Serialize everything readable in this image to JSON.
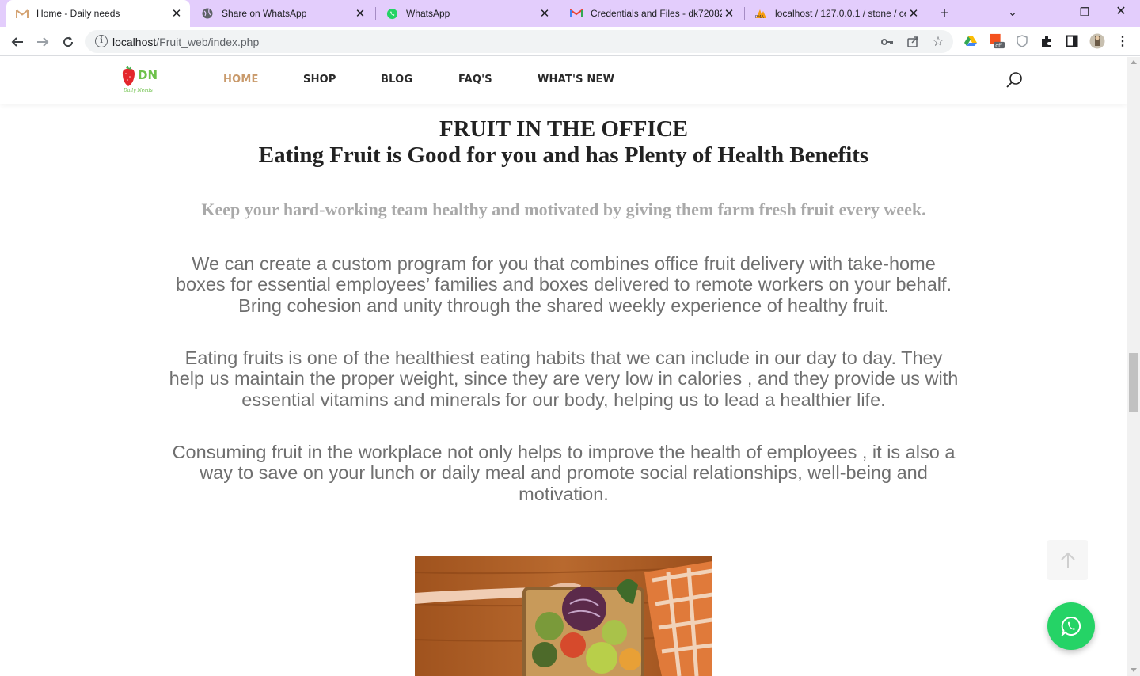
{
  "browser": {
    "tabs": [
      {
        "title": "Home - Daily needs",
        "icon": "gmail-icon",
        "active": true
      },
      {
        "title": "Share on WhatsApp",
        "icon": "globe-icon",
        "active": false
      },
      {
        "title": "WhatsApp",
        "icon": "whatsapp-icon",
        "active": false
      },
      {
        "title": "Credentials and Files - dk72082",
        "icon": "gmail-icon",
        "active": false
      },
      {
        "title": "localhost / 127.0.0.1 / stone / ce",
        "icon": "phpmyadmin-icon",
        "active": false
      }
    ],
    "url_host": "localhost",
    "url_path": "/Fruit_web/index.php",
    "extension_badge": "off"
  },
  "site": {
    "logo_text": "DN",
    "logo_subtext": "Daily Needs",
    "nav": [
      {
        "label": "HOME",
        "active": true
      },
      {
        "label": "SHOP",
        "active": false
      },
      {
        "label": "BLOG",
        "active": false
      },
      {
        "label": "FAQ'S",
        "active": false
      },
      {
        "label": "WHAT'S NEW",
        "active": false
      }
    ]
  },
  "content": {
    "heading": "FRUIT IN THE OFFICE",
    "subheading": "Eating Fruit is Good for you and has Plenty of Health Benefits",
    "tagline": "Keep your hard-working team healthy and motivated by giving them farm fresh fruit every week.",
    "paragraphs": [
      "We can create a custom program for you that combines office fruit delivery with take-home boxes for essential employees’ families and boxes delivered to remote workers on your behalf. Bring cohesion and unity through the shared weekly experience of healthy fruit.",
      "Eating fruits is one of the healthiest eating habits that we can include in our day to day. They help us maintain the proper weight, since they are very low in calories , and they provide us with essential vitamins and minerals for our body, helping us to lead a healthier life.",
      "Consuming fruit in the workplace not only helps to improve the health of employees , it is also a way to save on your lunch or daily meal and promote social relationships, well-being and motivation."
    ]
  },
  "colors": {
    "tabbar": "#e3cdfc",
    "nav_active": "#c99a6b",
    "whatsapp_green": "#25d366",
    "tagline_gray": "#a9a9a9",
    "body_text_gray": "#6f6f6f"
  }
}
